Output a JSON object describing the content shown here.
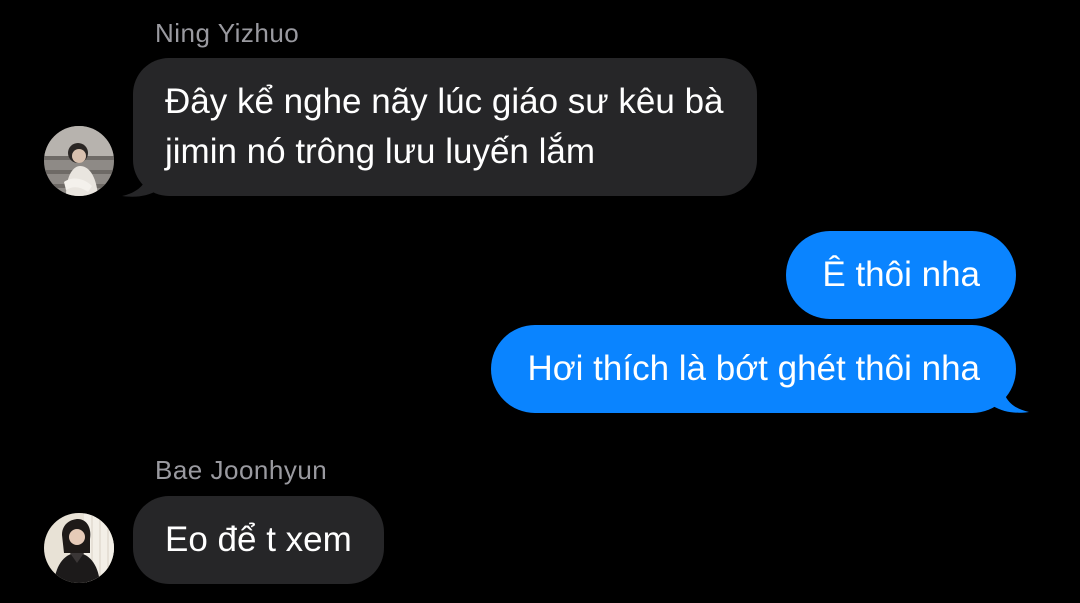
{
  "messages": [
    {
      "sender": "Ning Yizhuo",
      "direction": "incoming",
      "lines": [
        "Đây kể nghe nãy lúc giáo sư kêu bà",
        "jimin nó trông lưu luyến lắm"
      ],
      "avatar": "profile-photo"
    },
    {
      "direction": "outgoing",
      "text": "Ê thôi nha"
    },
    {
      "direction": "outgoing",
      "text": "Hơi thích là bớt ghét thôi nha"
    },
    {
      "sender": "Bae Joonhyun",
      "direction": "incoming",
      "text": "Eo để t xem",
      "avatar": "profile-photo"
    }
  ],
  "colors": {
    "background": "#000000",
    "incoming_bubble": "#262628",
    "outgoing_bubble": "#0a84ff",
    "sender_name": "#9a9aa0"
  }
}
